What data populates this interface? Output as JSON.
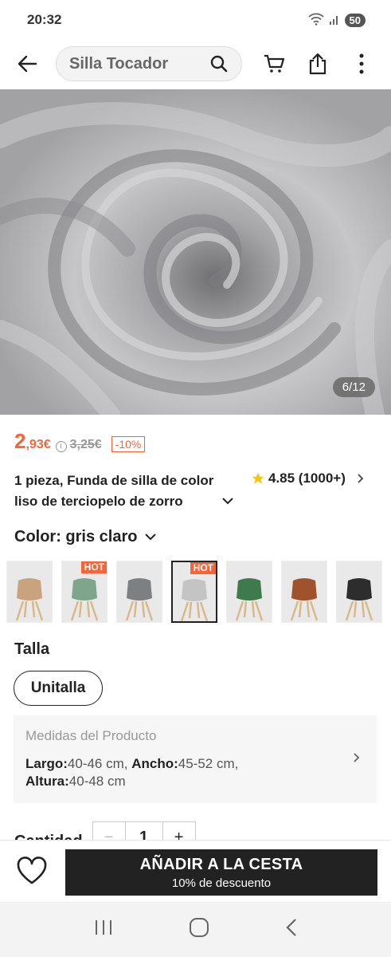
{
  "status_bar": {
    "time": "20:32",
    "battery": "50"
  },
  "header": {
    "search_text": "Silla Tocador"
  },
  "gallery": {
    "counter": "6/12"
  },
  "price": {
    "integer": "2",
    "decimals": ",93€",
    "original": "3,25€",
    "discount": "-10%"
  },
  "product": {
    "title": "1 pieza, Funda de silla de color liso de terciopelo de zorro",
    "rating": "4.85 (1000+)"
  },
  "color": {
    "label": "Color: gris claro",
    "swatches": [
      {
        "color": "#c9a27e",
        "hot": ""
      },
      {
        "color": "#7fa58c",
        "hot": "HOT"
      },
      {
        "color": "#7d7f80",
        "hot": ""
      },
      {
        "color": "#c4c4c4",
        "hot": "HOT"
      },
      {
        "color": "#3f7a4d",
        "hot": ""
      },
      {
        "color": "#a0522d",
        "hot": ""
      },
      {
        "color": "#2d2d2d",
        "hot": ""
      }
    ]
  },
  "size": {
    "label": "Talla",
    "option": "Unitalla"
  },
  "measures": {
    "title": "Medidas del Producto",
    "largo_label": "Largo:",
    "largo": "40-46 cm,",
    "ancho_label": "Ancho:",
    "ancho": "45-52 cm,",
    "altura_label": "Altura:",
    "altura": "40-48 cm"
  },
  "quantity": {
    "label": "Cantidad",
    "value": "1",
    "minus": "−",
    "plus": "+"
  },
  "cta": {
    "main": "AÑADIR A LA CESTA",
    "sub": "10% de descuento"
  }
}
